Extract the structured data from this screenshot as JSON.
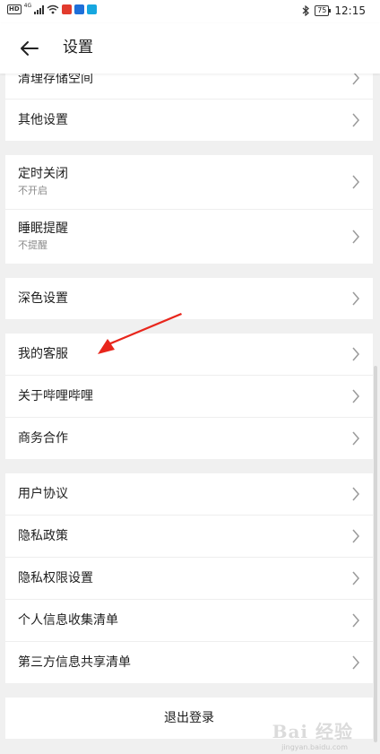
{
  "status_bar": {
    "left_chip": "HD",
    "network": "4G",
    "app_icon_colors": [
      "#e23b2d",
      "#1e6fd9",
      "#16a7e0"
    ],
    "battery": "75",
    "time": "12:15"
  },
  "header": {
    "title": "设置"
  },
  "groups": [
    {
      "items": [
        {
          "label": "清理存储空间",
          "clipped": true
        },
        {
          "label": "其他设置"
        }
      ]
    },
    {
      "items": [
        {
          "label": "定时关闭",
          "sub": "不开启"
        },
        {
          "label": "睡眠提醒",
          "sub": "不提醒"
        }
      ]
    },
    {
      "items": [
        {
          "label": "深色设置"
        }
      ]
    },
    {
      "items": [
        {
          "label": "我的客服"
        },
        {
          "label": "关于哔哩哔哩"
        },
        {
          "label": "商务合作"
        }
      ]
    },
    {
      "items": [
        {
          "label": "用户协议"
        },
        {
          "label": "隐私政策"
        },
        {
          "label": "隐私权限设置"
        },
        {
          "label": "个人信息收集清单"
        },
        {
          "label": "第三方信息共享清单"
        }
      ]
    }
  ],
  "logout_label": "退出登录",
  "annotation_color": "#e8261c",
  "watermark": "Bai 经验",
  "watermark_sub": "jingyan.baidu.com"
}
